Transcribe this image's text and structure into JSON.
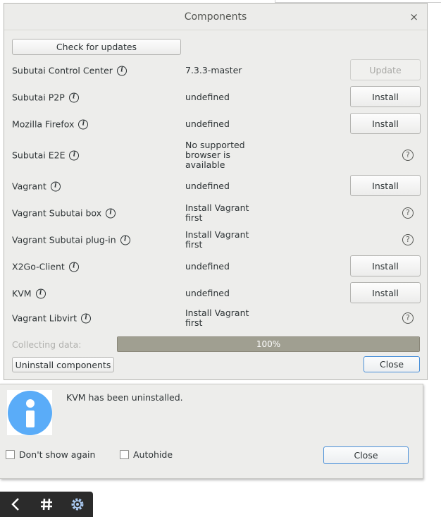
{
  "dialog": {
    "title": "Components",
    "close_glyph": "×",
    "check_updates_label": "Check for updates",
    "components": [
      {
        "name": "Subutai Control Center",
        "version": "7.3.3-master",
        "action": "Update",
        "action_type": "button-disabled"
      },
      {
        "name": "Subutai P2P",
        "version": "undefined",
        "action": "Install",
        "action_type": "button"
      },
      {
        "name": "Mozilla Firefox",
        "version": "undefined",
        "action": "Install",
        "action_type": "button"
      },
      {
        "name": "Subutai E2E",
        "version": "No supported\nbrowser is\navailable",
        "action": "?",
        "action_type": "help"
      },
      {
        "name": "Vagrant",
        "version": "undefined",
        "action": "Install",
        "action_type": "button"
      },
      {
        "name": "Vagrant Subutai box",
        "version": "Install Vagrant first",
        "action": "?",
        "action_type": "help"
      },
      {
        "name": "Vagrant Subutai plug-in",
        "version": "Install Vagrant first",
        "action": "?",
        "action_type": "help"
      },
      {
        "name": "X2Go-Client",
        "version": "undefined",
        "action": "Install",
        "action_type": "button"
      },
      {
        "name": "KVM",
        "version": "undefined",
        "action": "Install",
        "action_type": "button"
      },
      {
        "name": "Vagrant Libvirt",
        "version": "Install Vagrant first",
        "action": "?",
        "action_type": "help"
      }
    ],
    "collecting_label": "Collecting data:",
    "progress": {
      "text": "100%",
      "fraction": 1.0
    },
    "uninstall_label": "Uninstall components",
    "close_label": "Close"
  },
  "notification": {
    "message": "KVM has been uninstalled.",
    "dont_show_label": "Don't show again",
    "autohide_label": "Autohide",
    "close_label": "Close",
    "icon": "info-icon",
    "icon_color": "#5aacf8"
  },
  "taskbar": {
    "items": [
      "chevron-left-icon",
      "hash-icon",
      "gear-icon"
    ]
  }
}
